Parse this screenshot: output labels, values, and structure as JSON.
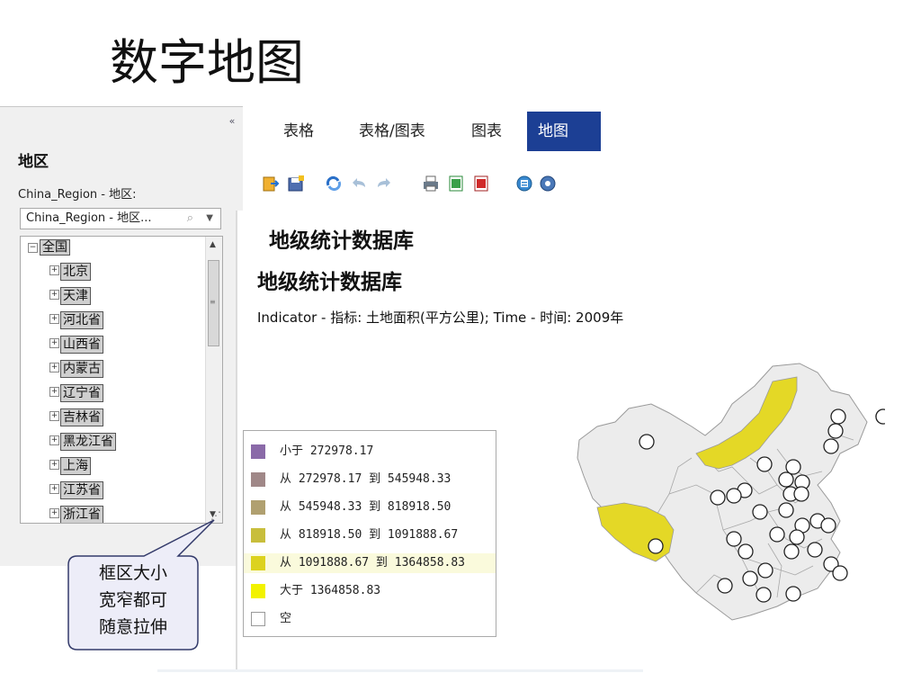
{
  "slide": {
    "title": "数字地图"
  },
  "panel": {
    "collapse_icon": "«",
    "heading": "地区",
    "field_label": "China_Region - 地区:",
    "select_value": "China_Region - 地区...",
    "tree": {
      "root": "全国",
      "items": [
        "北京",
        "天津",
        "河北省",
        "山西省",
        "内蒙古",
        "辽宁省",
        "吉林省",
        "黑龙江省",
        "上海",
        "江苏省",
        "浙江省"
      ]
    }
  },
  "tabs": [
    {
      "label": "表格",
      "active": false
    },
    {
      "label": "表格/图表",
      "active": false
    },
    {
      "label": "图表",
      "active": false
    },
    {
      "label": "地图",
      "active": true
    }
  ],
  "toolbar": {
    "icons": [
      "export-icon",
      "save-icon",
      "refresh-icon",
      "undo-icon",
      "redo-icon",
      "print-icon",
      "excel-icon",
      "pdf-icon",
      "info-icon",
      "settings-icon"
    ]
  },
  "report": {
    "title": "地级统计数据库",
    "subtitle": "地级统计数据库",
    "indicator": "Indicator - 指标: 土地面积(平方公里); Time - 时间: 2009年"
  },
  "legend": [
    {
      "label": "小于 272978.17",
      "color": "#8a6aa8"
    },
    {
      "label": "从 272978.17 到 545948.33",
      "color": "#a08888"
    },
    {
      "label": "从 545948.33 到 818918.50",
      "color": "#b0a070"
    },
    {
      "label": "从 818918.50 到 1091888.67",
      "color": "#c8be3c"
    },
    {
      "label": "从 1091888.67 到 1364858.83",
      "color": "#dcd21e",
      "highlight": true
    },
    {
      "label": "大于 1364858.83",
      "color": "#f2f200"
    },
    {
      "label": "空",
      "color": "#ffffff"
    }
  ],
  "callout": {
    "lines": [
      "框区大小",
      "宽窄都可",
      "随意拉伸"
    ]
  }
}
